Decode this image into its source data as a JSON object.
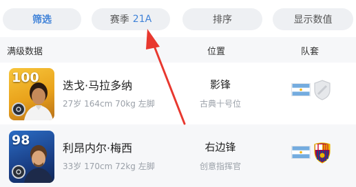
{
  "filters": {
    "filter_label": "筛选",
    "season_label": "赛季",
    "season_value": "21A",
    "sort_label": "排序",
    "display_label": "显示数值"
  },
  "header": {
    "name_col": "满级数据",
    "position_col": "位置",
    "team_col": "队套"
  },
  "players": [
    {
      "rating": "100",
      "name": "迭戈·马拉多纳",
      "info": "27岁 164cm 70kg 左脚",
      "position": "影锋",
      "role": "古典十号位",
      "nation": "argentina-flag-icon",
      "club": "generic-club-shield-icon",
      "card_style": "legend-gold"
    },
    {
      "rating": "98",
      "name": "利昂内尔·梅西",
      "info": "33岁 170cm 72kg 左脚",
      "position": "右边锋",
      "role": "创意指挥官",
      "nation": "argentina-flag-icon",
      "club": "fc-barcelona-crest-icon",
      "card_style": "featured-blue"
    }
  ],
  "colors": {
    "accent": "#3f82d8",
    "annotation": "#e8382f"
  }
}
